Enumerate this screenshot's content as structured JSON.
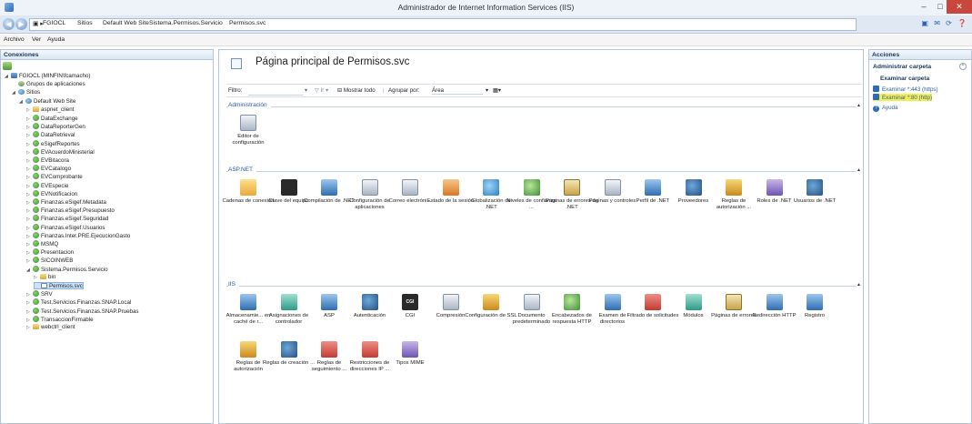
{
  "window": {
    "title": "Administrador de Internet Information Services (IIS)",
    "controls": [
      "–",
      "□",
      "✕"
    ]
  },
  "address": {
    "crumbs": [
      "FGIOCL",
      "Sitios",
      "Default Web Site",
      "Sistema.Permisos.Servicio",
      "Permisos.svc"
    ],
    "separator": "▸"
  },
  "menu": [
    "Archivo",
    "Ver",
    "Ayuda"
  ],
  "connections": {
    "title": "Conexiones",
    "tree": [
      {
        "label": "FGIOCL (MINFIN\\fcamacho)",
        "level": 0,
        "icon": "srv",
        "tri": "◢"
      },
      {
        "label": "Grupos de aplicaciones",
        "level": 1,
        "icon": "pool",
        "tri": ""
      },
      {
        "label": "Sitios",
        "level": 1,
        "icon": "web",
        "tri": "◢"
      },
      {
        "label": "Default Web Site",
        "level": 2,
        "icon": "web",
        "tri": "◢"
      },
      {
        "label": "aspnet_client",
        "level": 3,
        "icon": "fold",
        "tri": "▷"
      },
      {
        "label": "DataExchange",
        "level": 3,
        "icon": "app",
        "tri": "▷"
      },
      {
        "label": "DataReporterGen",
        "level": 3,
        "icon": "app",
        "tri": "▷"
      },
      {
        "label": "DataRetrieval",
        "level": 3,
        "icon": "app",
        "tri": "▷"
      },
      {
        "label": "eSigefReportes",
        "level": 3,
        "icon": "app",
        "tri": "▷"
      },
      {
        "label": "EVAcuerdoMinisterial",
        "level": 3,
        "icon": "app",
        "tri": "▷"
      },
      {
        "label": "EVBitacora",
        "level": 3,
        "icon": "app",
        "tri": "▷"
      },
      {
        "label": "EVCatalogo",
        "level": 3,
        "icon": "app",
        "tri": "▷"
      },
      {
        "label": "EVComprobante",
        "level": 3,
        "icon": "app",
        "tri": "▷"
      },
      {
        "label": "EVEspecie",
        "level": 3,
        "icon": "app",
        "tri": "▷"
      },
      {
        "label": "EVNotificacion",
        "level": 3,
        "icon": "app",
        "tri": "▷"
      },
      {
        "label": "Finanzas.eSigef.Metadata",
        "level": 3,
        "icon": "app",
        "tri": "▷"
      },
      {
        "label": "Finanzas.eSigef.Presupuesto",
        "level": 3,
        "icon": "app",
        "tri": "▷"
      },
      {
        "label": "Finanzas.eSigef.Seguridad",
        "level": 3,
        "icon": "app",
        "tri": "▷"
      },
      {
        "label": "Finanzas.eSigef.Usuarios",
        "level": 3,
        "icon": "app",
        "tri": "▷"
      },
      {
        "label": "Finanzas.Inter.PRE.EjecucionGasto",
        "level": 3,
        "icon": "app",
        "tri": "▷"
      },
      {
        "label": "MSMQ",
        "level": 3,
        "icon": "app",
        "tri": "▷"
      },
      {
        "label": "Presentacion",
        "level": 3,
        "icon": "app",
        "tri": "▷"
      },
      {
        "label": "SICOINWEB",
        "level": 3,
        "icon": "app",
        "tri": "▷"
      },
      {
        "label": "Sistema.Permisos.Servicio",
        "level": 3,
        "icon": "app",
        "tri": "◢"
      },
      {
        "label": "bin",
        "level": 4,
        "icon": "fold",
        "tri": "▷"
      },
      {
        "label": "Permisos.svc",
        "level": 4,
        "icon": "file",
        "tri": "",
        "selected": true
      },
      {
        "label": "SRV",
        "level": 3,
        "icon": "app",
        "tri": "▷"
      },
      {
        "label": "Test.Servicios.Finanzas.SNAP.Local",
        "level": 3,
        "icon": "app",
        "tri": "▷"
      },
      {
        "label": "Test.Servicios.Finanzas.SNAP.Pruebas",
        "level": 3,
        "icon": "app",
        "tri": "▷"
      },
      {
        "label": "TransaccionFirmable",
        "level": 3,
        "icon": "app",
        "tri": "▷"
      },
      {
        "label": "webctrl_client",
        "level": 3,
        "icon": "fold",
        "tri": "▷"
      }
    ]
  },
  "center": {
    "title": "Página principal de Permisos.svc",
    "filter_label": "Filtro:",
    "go_label": "Ir",
    "show_all_label": "Mostrar todo",
    "group_by_label": "Agrupar por:",
    "group_by_value": "Área",
    "sections": [
      {
        "title": "Administración",
        "items": [
          {
            "label": "Editor de configuración",
            "icon": "gray"
          }
        ]
      },
      {
        "title": "ASP.NET",
        "items": [
          {
            "label": "Cadenas de conexión",
            "icon": "fold"
          },
          {
            "label": "Clave del equipo",
            "icon": "dark"
          },
          {
            "label": "Compilación de .NET",
            "icon": "blue"
          },
          {
            "label": "Configuración de aplicaciones",
            "icon": "gray"
          },
          {
            "label": "Correo electróni...",
            "icon": "gray"
          },
          {
            "label": "Estado de la sesión",
            "icon": "orange"
          },
          {
            "label": "Globalización de .NET",
            "icon": "globe"
          },
          {
            "label": "Niveles de confianza ...",
            "icon": "green"
          },
          {
            "label": "Páginas de errores de .NET",
            "icon": "book"
          },
          {
            "label": "Páginas y controles",
            "icon": "gray"
          },
          {
            "label": "Perfil de .NET",
            "icon": "blue"
          },
          {
            "label": "Proveedores",
            "icon": "users"
          },
          {
            "label": "Reglas de autorización ...",
            "icon": "lock"
          },
          {
            "label": "Roles de .NET",
            "icon": "purple"
          },
          {
            "label": "Usuarios de .NET",
            "icon": "users"
          }
        ]
      },
      {
        "title": "IIS",
        "items": [
          {
            "label": "Almacenamie... en caché de r...",
            "icon": "blue"
          },
          {
            "label": "Asignaciones de controlador",
            "icon": "teal"
          },
          {
            "label": "ASP",
            "icon": "blue"
          },
          {
            "label": "Autenticación",
            "icon": "users"
          },
          {
            "label": "CGI",
            "icon": "dark",
            "text": "CGI"
          },
          {
            "label": "Compresión",
            "icon": "gray"
          },
          {
            "label": "Configuración de SSL",
            "icon": "lock"
          },
          {
            "label": "Documento predeterminado",
            "icon": "gray"
          },
          {
            "label": "Encabezados de respuesta HTTP",
            "icon": "green"
          },
          {
            "label": "Examen de directorios",
            "icon": "blue"
          },
          {
            "label": "Filtrado de solicitudes",
            "icon": "red"
          },
          {
            "label": "Módulos",
            "icon": "teal"
          },
          {
            "label": "Páginas de errores",
            "icon": "book"
          },
          {
            "label": "Redirección HTTP",
            "icon": "blue"
          },
          {
            "label": "Registro",
            "icon": "blue"
          },
          {
            "label": "Reglas de autorización",
            "icon": "lock"
          },
          {
            "label": "Reglas de creación ...",
            "icon": "users"
          },
          {
            "label": "Reglas de seguimiento ...",
            "icon": "red"
          },
          {
            "label": "Restricciones de direcciones IP ...",
            "icon": "red"
          },
          {
            "label": "Tipos MIME",
            "icon": "purple"
          }
        ]
      }
    ]
  },
  "actions": {
    "title": "Acciones",
    "group": "Administrar carpeta",
    "sub": "Examinar carpeta",
    "links": [
      {
        "label": "Examinar *:443 (https)",
        "highlight": false
      },
      {
        "label": "Examinar *:80 (http)",
        "highlight": true
      }
    ],
    "help": "Ayuda"
  }
}
